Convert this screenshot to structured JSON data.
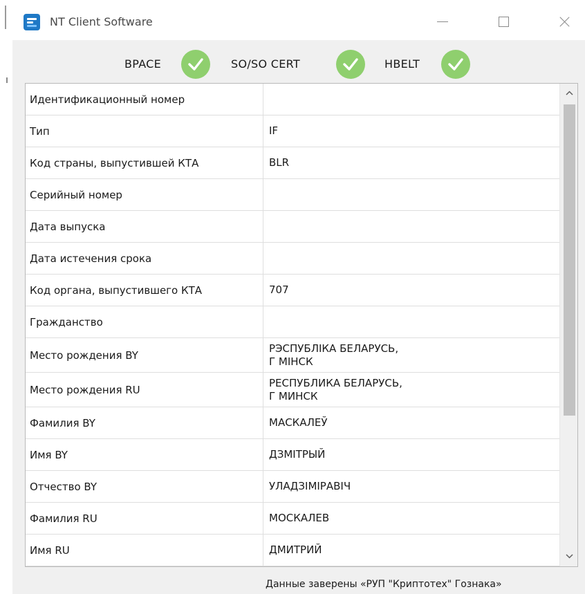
{
  "window": {
    "title": "NT Client Software"
  },
  "status_checks": [
    {
      "label": "BPACE",
      "status": "passed"
    },
    {
      "label": "SO/SO CERT",
      "status": "passed"
    },
    {
      "label": "HBELT",
      "status": "passed"
    }
  ],
  "check_color": "#8fcf6e",
  "rows": [
    {
      "label": "Идентификационный номер",
      "value": ""
    },
    {
      "label": "Тип",
      "value": "IF"
    },
    {
      "label": "Код страны, выпустившей КТА",
      "value": "BLR"
    },
    {
      "label": "Серийный номер",
      "value": ""
    },
    {
      "label": "Дата выпуска",
      "value": ""
    },
    {
      "label": "Дата истечения срока",
      "value": ""
    },
    {
      "label": "Код органа, выпустившего КТА",
      "value": "707"
    },
    {
      "label": "Гражданство",
      "value": ""
    },
    {
      "label": "Место рождения BY",
      "value_line1": "РЭСПУБЛІКА БЕЛАРУСЬ,",
      "value_line2": "Г МІНСК"
    },
    {
      "label": "Место рождения RU",
      "value_line1": "РЕСПУБЛИКА БЕЛАРУСЬ,",
      "value_line2": "Г МИНСК"
    },
    {
      "label": "Фамилия BY",
      "value": "МАСКАЛЕЎ"
    },
    {
      "label": "Имя BY",
      "value": "ДЗМІТРЫЙ"
    },
    {
      "label": "Отчество BY",
      "value": "УЛАДЗІМІРАВІЧ"
    },
    {
      "label": "Фамилия RU",
      "value": "МОСКАЛЕВ"
    },
    {
      "label": "Имя RU",
      "value": "ДМИТРИЙ"
    }
  ],
  "footer": {
    "text": "Данные заверены «РУП \"Криптотех\" Гознака»"
  }
}
